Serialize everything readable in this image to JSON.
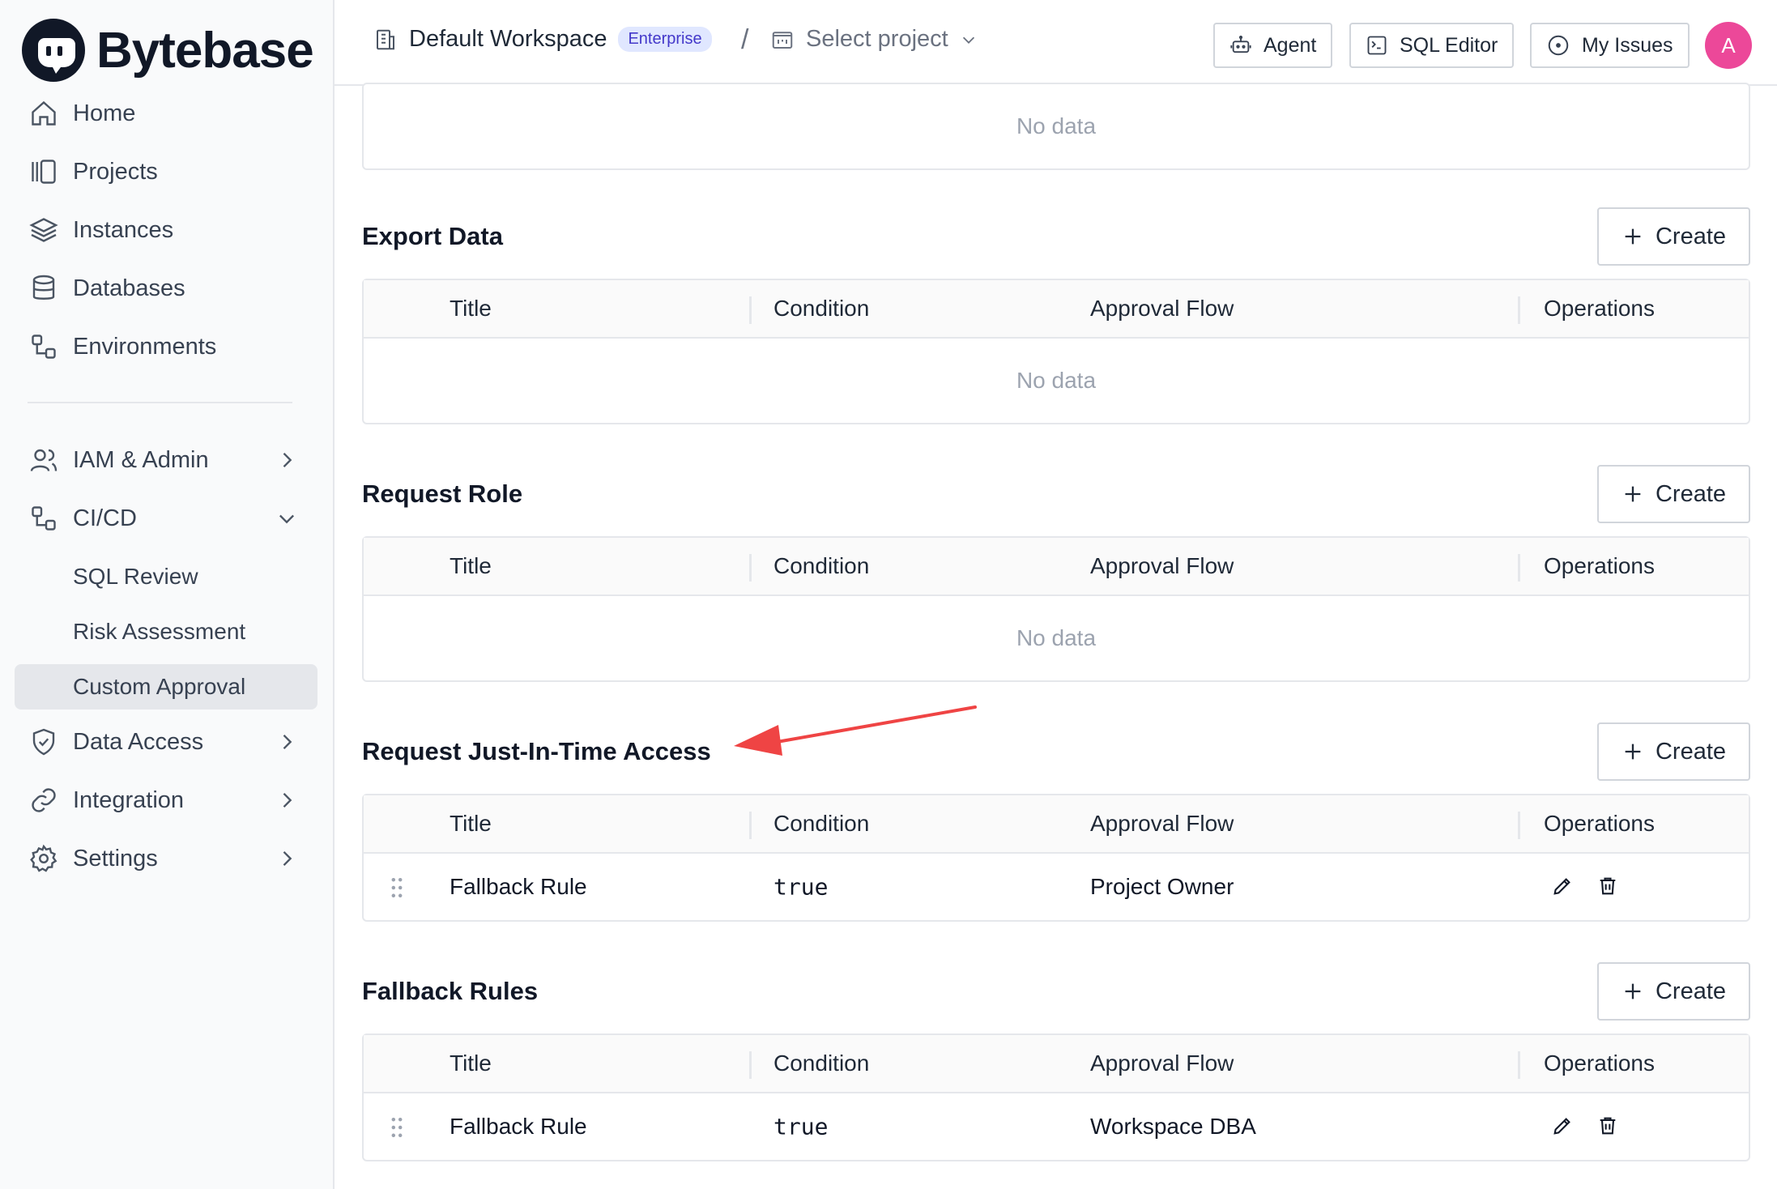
{
  "brand": {
    "name": "Bytebase"
  },
  "sidebar": {
    "items": [
      {
        "label": "Home",
        "icon": "home-icon"
      },
      {
        "label": "Projects",
        "icon": "projects-icon"
      },
      {
        "label": "Instances",
        "icon": "layers-icon"
      },
      {
        "label": "Databases",
        "icon": "database-icon"
      },
      {
        "label": "Environments",
        "icon": "environments-icon"
      }
    ],
    "groups": [
      {
        "label": "IAM & Admin",
        "icon": "users-icon",
        "expanded": false
      },
      {
        "label": "CI/CD",
        "icon": "workflow-icon",
        "expanded": true,
        "children": [
          {
            "label": "SQL Review"
          },
          {
            "label": "Risk Assessment"
          },
          {
            "label": "Custom Approval",
            "active": true
          }
        ]
      },
      {
        "label": "Data Access",
        "icon": "shield-icon",
        "expanded": false
      },
      {
        "label": "Integration",
        "icon": "link-icon",
        "expanded": false
      },
      {
        "label": "Settings",
        "icon": "gear-icon",
        "expanded": false
      }
    ]
  },
  "header": {
    "workspace": "Default Workspace",
    "plan_badge": "Enterprise",
    "separator": "/",
    "project_placeholder": "Select project",
    "buttons": {
      "agent": "Agent",
      "sql_editor": "SQL Editor",
      "my_issues": "My Issues"
    },
    "avatar_initial": "A"
  },
  "table_columns": {
    "title": "Title",
    "condition": "Condition",
    "approval_flow": "Approval Flow",
    "operations": "Operations"
  },
  "top_card": {
    "empty_text": "No data"
  },
  "sections": [
    {
      "title": "Export Data",
      "create_label": "Create",
      "empty_text": "No data",
      "rows": []
    },
    {
      "title": "Request Role",
      "create_label": "Create",
      "empty_text": "No data",
      "rows": []
    },
    {
      "title": "Request Just-In-Time Access",
      "create_label": "Create",
      "rows": [
        {
          "title": "Fallback Rule",
          "condition": "true",
          "approval_flow": "Project Owner"
        }
      ]
    },
    {
      "title": "Fallback Rules",
      "create_label": "Create",
      "rows": [
        {
          "title": "Fallback Rule",
          "condition": "true",
          "approval_flow": "Workspace DBA"
        }
      ]
    }
  ],
  "colors": {
    "accent_badge_bg": "#e0e7ff",
    "accent_badge_text": "#4338ca",
    "avatar": "#ec4899",
    "annotation_arrow": "#ef4444"
  }
}
